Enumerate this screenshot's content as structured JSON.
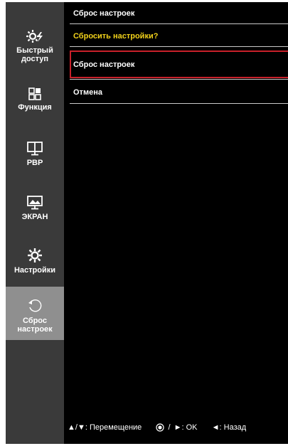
{
  "sidebar": {
    "items": [
      {
        "label_line1": "Быстрый",
        "label_line2": "доступ",
        "icon": "quick-settings-icon"
      },
      {
        "label_line1": "Функция",
        "icon": "function-grid-icon"
      },
      {
        "label_line1": "PBP",
        "icon": "pbp-monitor-icon"
      },
      {
        "label_line1": "ЭКРАН",
        "icon": "screen-picture-icon"
      },
      {
        "label_line1": "Настройки",
        "icon": "gear-icon"
      },
      {
        "label_line1": "Сброс",
        "label_line2": "настроек",
        "icon": "reset-arrow-icon",
        "active": true
      }
    ]
  },
  "main": {
    "header": "Сброс настроек",
    "question": "Сбросить настройки?",
    "options": [
      "Сброс настроек",
      "Отмена"
    ]
  },
  "footer": {
    "move_symbol": "▲/▼",
    "move_label": ": Перемещение",
    "ok_label": ": OK",
    "back_label": ": Назад"
  },
  "colors": {
    "question": "#f2d21b",
    "selection_border": "#c8202a",
    "sidebar_bg": "#3a3a3a",
    "sidebar_active_bg": "#8f8f8f"
  }
}
